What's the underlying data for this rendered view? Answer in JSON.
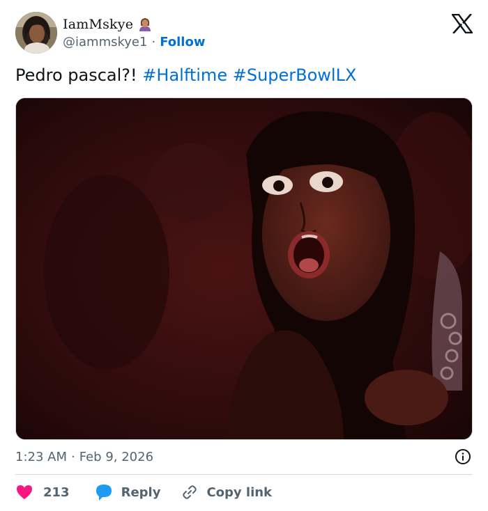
{
  "author": {
    "display_name": "IamMskye",
    "handle": "@iammskye1",
    "separator": "·",
    "follow_label": "Follow"
  },
  "tweet": {
    "text": "Pedro pascal?!",
    "hashtags": [
      "#Halftime",
      "#SuperBowlLX"
    ],
    "time": "1:23 AM",
    "date_separator": "·",
    "date": "Feb 9, 2026"
  },
  "actions": {
    "like_count": "213",
    "reply_label": "Reply",
    "copy_link_label": "Copy link"
  },
  "colors": {
    "link_blue": "#006fd6",
    "like_red": "#f91880",
    "reply_blue": "#1d9bf0",
    "muted_text": "#536471",
    "divider": "#cfd9de"
  },
  "icons": [
    "x-logo-icon",
    "woman-emoji-icon",
    "info-icon",
    "heart-icon",
    "reply-bubble-icon",
    "link-icon"
  ]
}
